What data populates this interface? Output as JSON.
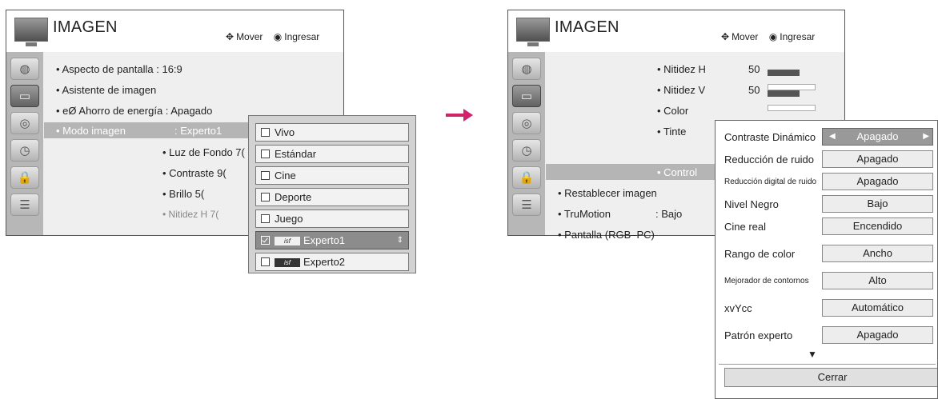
{
  "left_panel": {
    "title": "IMAGEN",
    "help_move_icon": "move-arrows-icon",
    "help_move": "Mover",
    "help_enter_icon": "ok-button-icon",
    "help_enter": "Ingresar",
    "menu": {
      "aspecto": "• Aspecto de pantalla : 16:9",
      "asistente": "• Asistente de imagen",
      "ahorro": "• eØ Ahorro de energía : Apagado",
      "modo_label": "• Modo imagen",
      "modo_value": ": Experto1",
      "luz": "• Luz de Fondo 7(",
      "contraste": "• Contraste     9(",
      "brillo": "• Brillo          5(",
      "nitidez": "• Nitidez H      7("
    },
    "dropdown": [
      {
        "label": "Vivo"
      },
      {
        "label": "Estándar"
      },
      {
        "label": "Cine"
      },
      {
        "label": "Deporte"
      },
      {
        "label": "Juego"
      },
      {
        "label": "Experto1",
        "selected": true
      },
      {
        "label": "Experto2"
      }
    ],
    "isf_badge": "isf"
  },
  "right_panel": {
    "title": "IMAGEN",
    "help_move": "Mover",
    "help_enter": "Ingresar",
    "menu": {
      "nitidez_h_label": "• Nitidez H",
      "nitidez_h_value": "50",
      "nitidez_v_label": "• Nitidez V",
      "nitidez_v_value": "50",
      "color": "• Color",
      "tinte": "• Tinte",
      "control": "• Control",
      "restablecer": "• Restablecer imagen",
      "trumotion_label": "• TruMotion",
      "trumotion_value": ": Bajo",
      "pantalla": "• Pantalla (RGB–PC)"
    },
    "settings": [
      {
        "label": "Contraste Dinámico",
        "value": "Apagado",
        "selected": true
      },
      {
        "label": "Reducción de ruido",
        "value": "Apagado"
      },
      {
        "label": "Reducción digital de ruido",
        "value": "Apagado",
        "small": true
      },
      {
        "label": "Nivel Negro",
        "value": "Bajo"
      },
      {
        "label": "Cine real",
        "value": "Encendido"
      },
      {
        "label": "Rango de color",
        "value": "Ancho"
      },
      {
        "label": "Mejorador de contornos",
        "value": "Alto",
        "small": true
      },
      {
        "label": "xvYcc",
        "value": "Automático"
      },
      {
        "label": "Patrón experto",
        "value": "Apagado"
      }
    ],
    "more_indicator": "▼",
    "close_label": "Cerrar"
  },
  "colors": {
    "arrow": "#d2226a",
    "highlight": "#b5b5b5"
  }
}
